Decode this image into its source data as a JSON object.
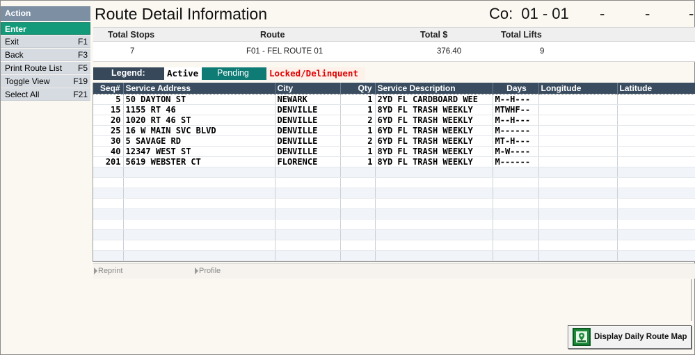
{
  "sidebar": {
    "header": "Action",
    "enter": "Enter",
    "items": [
      {
        "label": "Exit",
        "key": "F1"
      },
      {
        "label": "Back",
        "key": "F3"
      },
      {
        "label": "Print Route List",
        "key": "F5"
      },
      {
        "label": "Toggle View",
        "key": "F19"
      },
      {
        "label": "Select All",
        "key": "F21"
      }
    ]
  },
  "header": {
    "title": "Route Detail Information",
    "company_label": "Co:",
    "company_value": "01 - 01",
    "dash1": "-",
    "dash2": "-",
    "dash3": "-"
  },
  "summary": {
    "headers": {
      "total_stops": "Total Stops",
      "route": "Route",
      "total_amount": "Total $",
      "total_lifts": "Total Lifts"
    },
    "values": {
      "total_stops": "7",
      "route": "F01 - FEL ROUTE 01",
      "total_amount": "376.40",
      "total_lifts": "9"
    }
  },
  "legend": {
    "label": "Legend:",
    "active": "Active",
    "pending": "Pending",
    "locked": "Locked/Delinquent"
  },
  "grid": {
    "columns": [
      "Seq#",
      "Service Address",
      "City",
      "Qty",
      "Service Description",
      "Days",
      "Longitude",
      "Latitude"
    ],
    "rows": [
      {
        "seq": "5",
        "address": "50 DAYTON ST",
        "city": "NEWARK",
        "qty": "1",
        "description": "2YD FL CARDBOARD WEE",
        "days": "M--H---",
        "longitude": "",
        "latitude": ""
      },
      {
        "seq": "15",
        "address": "1155 RT 46",
        "city": "DENVILLE",
        "qty": "1",
        "description": "8YD FL TRASH WEEKLY",
        "days": "MTWHF--",
        "longitude": "",
        "latitude": ""
      },
      {
        "seq": "20",
        "address": "1020 RT 46 ST",
        "city": "DENVILLE",
        "qty": "2",
        "description": "6YD FL TRASH WEEKLY",
        "days": "M--H---",
        "longitude": "",
        "latitude": ""
      },
      {
        "seq": "25",
        "address": "16 W MAIN SVC BLVD",
        "city": "DENVILLE",
        "qty": "1",
        "description": "6YD FL TRASH WEEKLY",
        "days": "M------",
        "longitude": "",
        "latitude": ""
      },
      {
        "seq": "30",
        "address": "5 SAVAGE RD",
        "city": "DENVILLE",
        "qty": "2",
        "description": "6YD FL TRASH WEEKLY",
        "days": "MT-H---",
        "longitude": "",
        "latitude": ""
      },
      {
        "seq": "40",
        "address": "12347 WEST ST",
        "city": "DENVILLE",
        "qty": "1",
        "description": "8YD FL TRASH WEEKLY",
        "days": "M-W----",
        "longitude": "",
        "latitude": ""
      },
      {
        "seq": "201",
        "address": "5619 WEBSTER CT",
        "city": "FLORENCE",
        "qty": "1",
        "description": "8YD FL TRASH WEEKLY",
        "days": "M------",
        "longitude": "",
        "latitude": ""
      }
    ]
  },
  "footer": {
    "reprint": "Reprint",
    "profile": "Profile"
  },
  "map_button": {
    "label": "Display Daily Route Map"
  },
  "colors": {
    "accent": "#129a7a",
    "header_bg": "#3a4d60",
    "pending": "#0f7b75",
    "locked_text": "#e00000"
  }
}
